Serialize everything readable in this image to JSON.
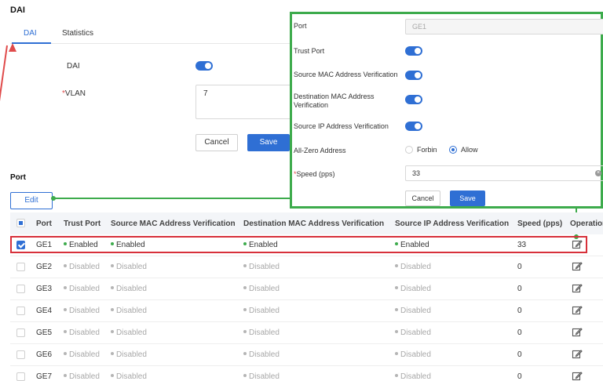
{
  "page_title": "DAI",
  "tabs": [
    {
      "label": "DAI",
      "active": true
    },
    {
      "label": "Statistics",
      "active": false
    }
  ],
  "form": {
    "dai_label": "DAI",
    "dai_enabled": true,
    "vlan_label": "VLAN",
    "vlan_value": "7",
    "cancel_label": "Cancel",
    "save_label": "Save"
  },
  "port_section": {
    "title": "Port",
    "edit_label": "Edit"
  },
  "table": {
    "columns": [
      "Port",
      "Trust Port",
      "Source MAC Address Verification",
      "Destination MAC Address Verification",
      "Source IP Address Verification",
      "Speed (pps)",
      "Operation"
    ],
    "rows": [
      {
        "port": "GE1",
        "trust": "Enabled",
        "src_mac": "Enabled",
        "dst_mac": "Enabled",
        "src_ip": "Enabled",
        "speed": "33",
        "checked": true,
        "enabled": true
      },
      {
        "port": "GE2",
        "trust": "Disabled",
        "src_mac": "Disabled",
        "dst_mac": "Disabled",
        "src_ip": "Disabled",
        "speed": "0",
        "checked": false,
        "enabled": false
      },
      {
        "port": "GE3",
        "trust": "Disabled",
        "src_mac": "Disabled",
        "dst_mac": "Disabled",
        "src_ip": "Disabled",
        "speed": "0",
        "checked": false,
        "enabled": false
      },
      {
        "port": "GE4",
        "trust": "Disabled",
        "src_mac": "Disabled",
        "dst_mac": "Disabled",
        "src_ip": "Disabled",
        "speed": "0",
        "checked": false,
        "enabled": false
      },
      {
        "port": "GE5",
        "trust": "Disabled",
        "src_mac": "Disabled",
        "dst_mac": "Disabled",
        "src_ip": "Disabled",
        "speed": "0",
        "checked": false,
        "enabled": false
      },
      {
        "port": "GE6",
        "trust": "Disabled",
        "src_mac": "Disabled",
        "dst_mac": "Disabled",
        "src_ip": "Disabled",
        "speed": "0",
        "checked": false,
        "enabled": false
      },
      {
        "port": "GE7",
        "trust": "Disabled",
        "src_mac": "Disabled",
        "dst_mac": "Disabled",
        "src_ip": "Disabled",
        "speed": "0",
        "checked": false,
        "enabled": false
      }
    ]
  },
  "edit_panel": {
    "port_label": "Port",
    "port_value": "GE1",
    "trust_port_label": "Trust Port",
    "trust_port_on": true,
    "src_mac_label": "Source MAC Address Verification",
    "src_mac_on": true,
    "dst_mac_label": "Destination MAC Address Verification",
    "dst_mac_on": true,
    "src_ip_label": "Source IP Address Verification",
    "src_ip_on": true,
    "all_zero_label": "All-Zero Address",
    "all_zero_options": [
      "Forbin",
      "Allow"
    ],
    "all_zero_selected": "Allow",
    "speed_label": "Speed (pps)",
    "speed_value": "33",
    "cancel_label": "Cancel",
    "save_label": "Save"
  },
  "colors": {
    "accent": "#2f6fd4",
    "highlight_green": "#3dab4c",
    "highlight_red": "#d7303a",
    "enabled_dot": "#3dab4c"
  }
}
